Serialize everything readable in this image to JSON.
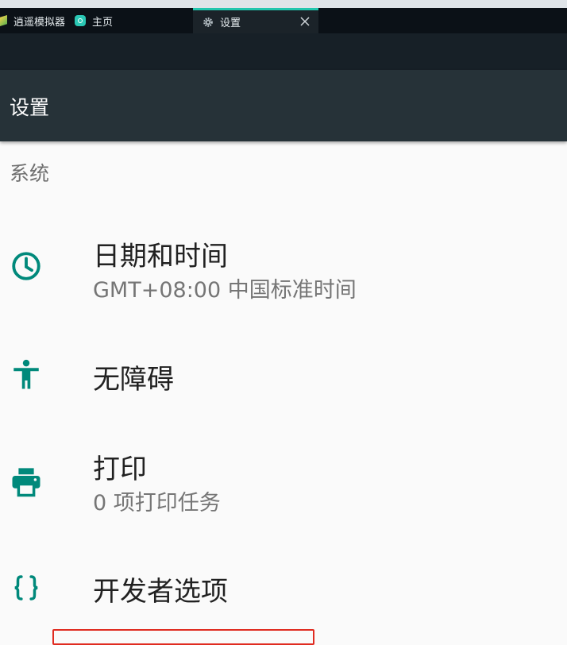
{
  "window": {
    "tabs": [
      {
        "label": "逍遥模拟器"
      },
      {
        "label": "主页"
      },
      {
        "label": "设置"
      }
    ]
  },
  "appbar": {
    "title": "设置"
  },
  "section": {
    "title": "系统"
  },
  "items": [
    {
      "title": "日期和时间",
      "summary": "GMT+08:00 中国标准时间",
      "icon": "clock-icon"
    },
    {
      "title": "无障碍",
      "icon": "accessibility-icon"
    },
    {
      "title": "打印",
      "summary": "0 项打印任务",
      "icon": "printer-icon"
    },
    {
      "title": "开发者选项",
      "icon": "braces-icon"
    }
  ],
  "colors": {
    "accent": "#00897b",
    "appbar": "#263238",
    "tab_accent": "#21c6ad",
    "highlight": "#e02b20"
  }
}
